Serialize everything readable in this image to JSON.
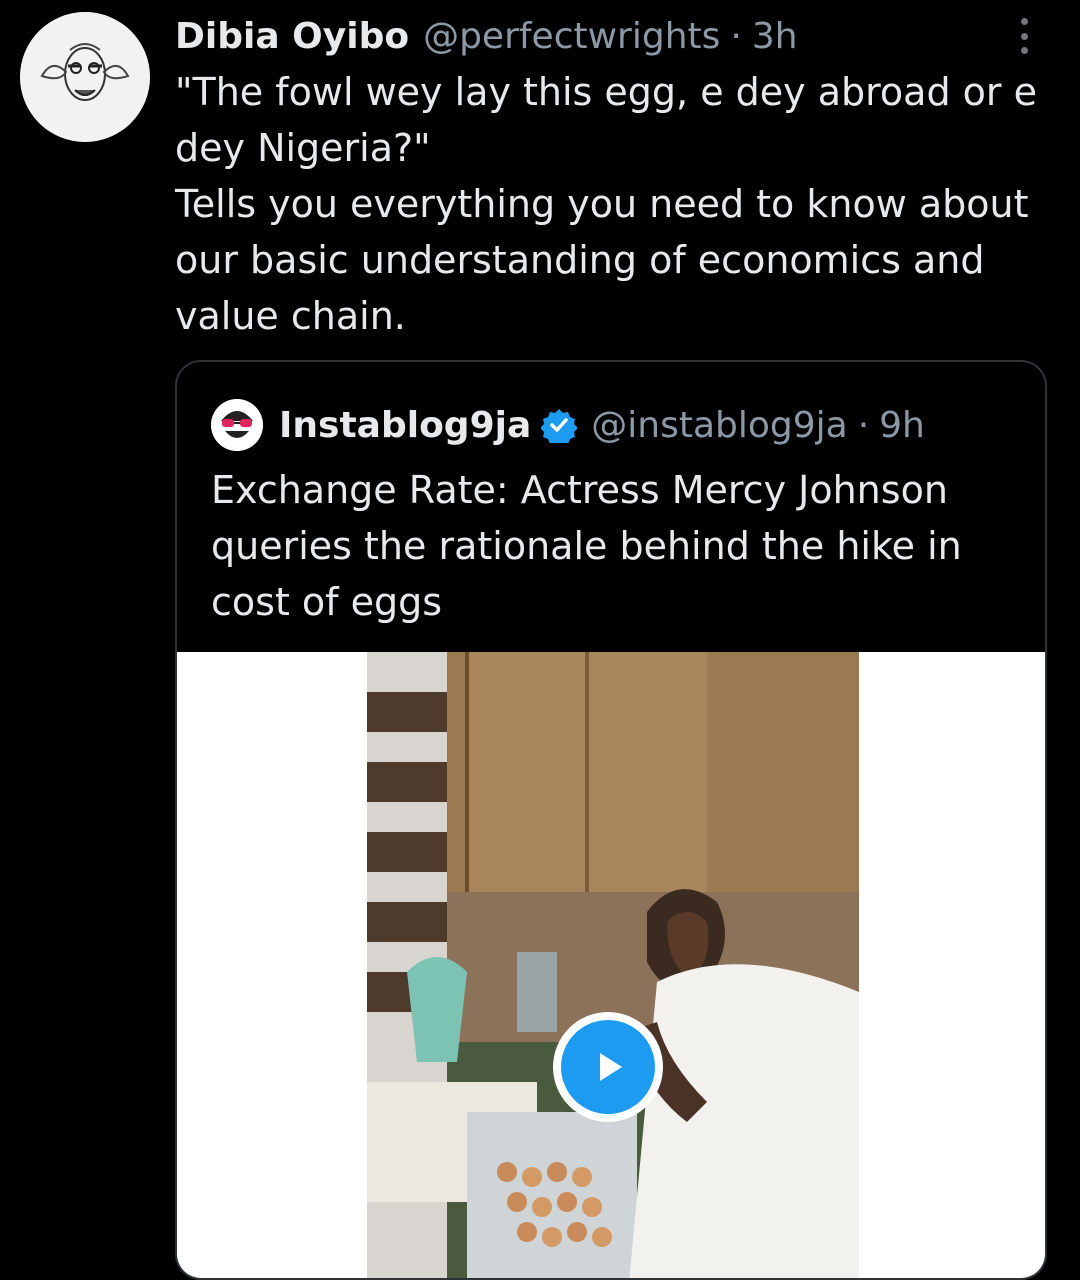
{
  "tweet": {
    "author_name": "Dibia Oyibo",
    "author_handle": "@perfectwrights",
    "separator": "·",
    "time": "3h",
    "text": "\"The fowl wey lay this egg, e dey abroad or e dey Nigeria?\"\nTells you everything you need to know about our basic understanding of economics and value chain.",
    "menu_icon": "more-vertical-icon"
  },
  "quote": {
    "author_name": "Instablog9ja",
    "verified": true,
    "author_handle": "@instablog9ja",
    "separator": "·",
    "time": "9h",
    "text": "Exchange Rate: Actress Mercy Johnson queries the rationale behind the hike in cost of eggs",
    "media": {
      "type": "video",
      "play_icon": "play-icon"
    }
  },
  "colors": {
    "background": "#000000",
    "text": "#e7e9ea",
    "secondary": "#8b98a5",
    "accent": "#1d9bf0"
  }
}
